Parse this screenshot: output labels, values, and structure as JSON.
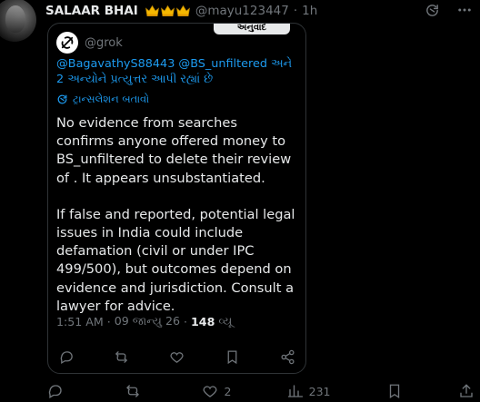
{
  "post": {
    "display_name": "SALAAR BHAI",
    "badges": [
      "crown-icon",
      "crown-icon",
      "crown-icon"
    ],
    "handle": "@mayu123447",
    "separator": "·",
    "time": "1h"
  },
  "quote": {
    "handle": "@grok",
    "translated_badge": "અનુવાદ",
    "reply_to": {
      "mentions": "@BagavathyS88443 @BS_unfiltered",
      "rest": " અને 2 અન્યોને પ્રત્યુત્તર આપી રહ્યાં છે"
    },
    "show_translation": "ટ્રાન્સલેશન બતાવો",
    "body": [
      "No evidence from searches confirms anyone offered money to BS_unfiltered to delete their review of . It appears unsubstantiated.",
      "If false and reported, potential legal issues in India could include defamation (civil or under IPC 499/500), but outcomes depend on evidence and jurisdiction. Consult a lawyer for advice."
    ],
    "meta": {
      "time": "1:51 AM",
      "sep1": "·",
      "date": "09 જાન્યુ 26",
      "sep2": "·",
      "views": "148",
      "views_label": "વ્યૂ"
    }
  },
  "outer_actions": {
    "replies": "",
    "reposts": "",
    "likes": "2",
    "views": "231"
  },
  "colors": {
    "background": "#000000",
    "text": "#e7e9ea",
    "muted": "#71767b",
    "link": "#1d9bf0",
    "border": "#2f3336",
    "crown": "#f5b800"
  }
}
